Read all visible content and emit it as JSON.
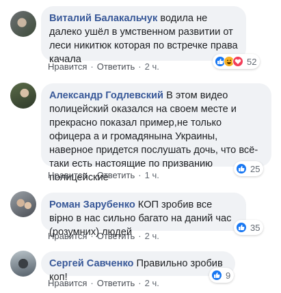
{
  "comments": [
    {
      "author": "Виталий Балакальчук",
      "text": " водила не далеко ушёл в умственном развитии от леси никитюк которая по встречке права качала",
      "like_label": "Нравится",
      "reply_label": "Ответить",
      "time": "2 ч.",
      "reaction_count": "52",
      "reactions": [
        "like-icon",
        "haha-icon",
        "love-icon"
      ]
    },
    {
      "author": "Александр Годлевский",
      "text": " В этом видео полицейский оказался на своем месте и прекрасно показал пример,не только офицера а и громадянына Украины, наверное придется послушать дочь, что всё-таки есть настоящие по призванию полицейские",
      "like_label": "Нравится",
      "reply_label": "Ответить",
      "time": "1 ч.",
      "reaction_count": "25",
      "reactions": [
        "like-icon"
      ]
    },
    {
      "author": "Роман Зарубенко",
      "text": " КОП зробив все вірно в нас сильно багато на даний час (розумних) людей",
      "like_label": "Нравится",
      "reply_label": "Ответить",
      "time": "2 ч.",
      "reaction_count": "35",
      "reactions": [
        "like-icon"
      ]
    },
    {
      "author": "Сергей Савченко",
      "text": " Правильно зробив коп!",
      "like_label": "Нравится",
      "reply_label": "Ответить",
      "time": "2 ч.",
      "reaction_count": "9",
      "reactions": [
        "like-icon"
      ]
    }
  ],
  "colors": {
    "author": "#385898",
    "like": "#1877f2",
    "love": "#f33e58",
    "haha": "#f7b125",
    "bubble": "#f0f2f5"
  }
}
